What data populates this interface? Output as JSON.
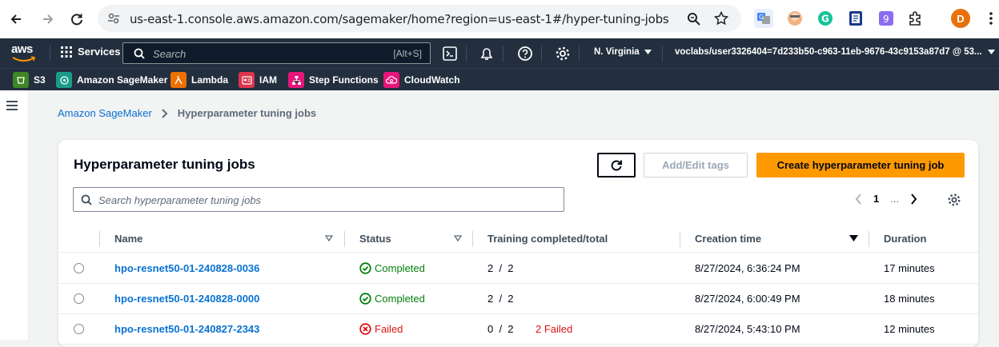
{
  "browser": {
    "url": "us-east-1.console.aws.amazon.com/sagemaker/home?region=us-east-1#/hyper-tuning-jobs",
    "profile_initial": "D"
  },
  "aws_nav": {
    "logo": "aws",
    "services_label": "Services",
    "search_placeholder": "Search",
    "search_shortcut": "[Alt+S]",
    "region": "N. Virginia",
    "account": "voclabs/user3326404=7d233b50-c963-11eb-9676-43c9153a87d7 @ 53..."
  },
  "favorites": [
    {
      "label": "S3",
      "icon": "s3-icon",
      "color": "#3f8624"
    },
    {
      "label": "Amazon SageMaker",
      "icon": "sagemaker-icon",
      "color": "#1a9c8a"
    },
    {
      "label": "Lambda",
      "icon": "lambda-icon",
      "color": "#ed7100"
    },
    {
      "label": "IAM",
      "icon": "iam-icon",
      "color": "#dd344c"
    },
    {
      "label": "Step Functions",
      "icon": "step-functions-icon",
      "color": "#e7157b"
    },
    {
      "label": "CloudWatch",
      "icon": "cloudwatch-icon",
      "color": "#e7157b"
    }
  ],
  "breadcrumb": {
    "parent": "Amazon SageMaker",
    "current": "Hyperparameter tuning jobs"
  },
  "panel": {
    "title": "Hyperparameter tuning jobs",
    "add_edit_tags": "Add/Edit tags",
    "create_button": "Create hyperparameter tuning job",
    "search_placeholder": "Search hyperparameter tuning jobs",
    "page_number": "1",
    "page_more": "..."
  },
  "table": {
    "columns": {
      "name": "Name",
      "status": "Status",
      "training": "Training completed/total",
      "creation": "Creation time",
      "duration": "Duration"
    },
    "rows": [
      {
        "name": "hpo-resnet50-01-240828-0036",
        "status": "Completed",
        "status_kind": "ok",
        "completed": "2",
        "total": "2",
        "failed": "",
        "creation": "8/27/2024, 6:36:24 PM",
        "duration": "17 minutes"
      },
      {
        "name": "hpo-resnet50-01-240828-0000",
        "status": "Completed",
        "status_kind": "ok",
        "completed": "2",
        "total": "2",
        "failed": "",
        "creation": "8/27/2024, 6:00:49 PM",
        "duration": "18 minutes"
      },
      {
        "name": "hpo-resnet50-01-240827-2343",
        "status": "Failed",
        "status_kind": "fail",
        "completed": "0",
        "total": "2",
        "failed": "2 Failed",
        "creation": "8/27/2024, 5:43:10 PM",
        "duration": "12 minutes"
      }
    ]
  },
  "colors": {
    "link": "#0972d3",
    "success": "#037f0c",
    "error": "#d91515",
    "primary_button": "#ff9900",
    "aws_nav": "#232f3e"
  }
}
